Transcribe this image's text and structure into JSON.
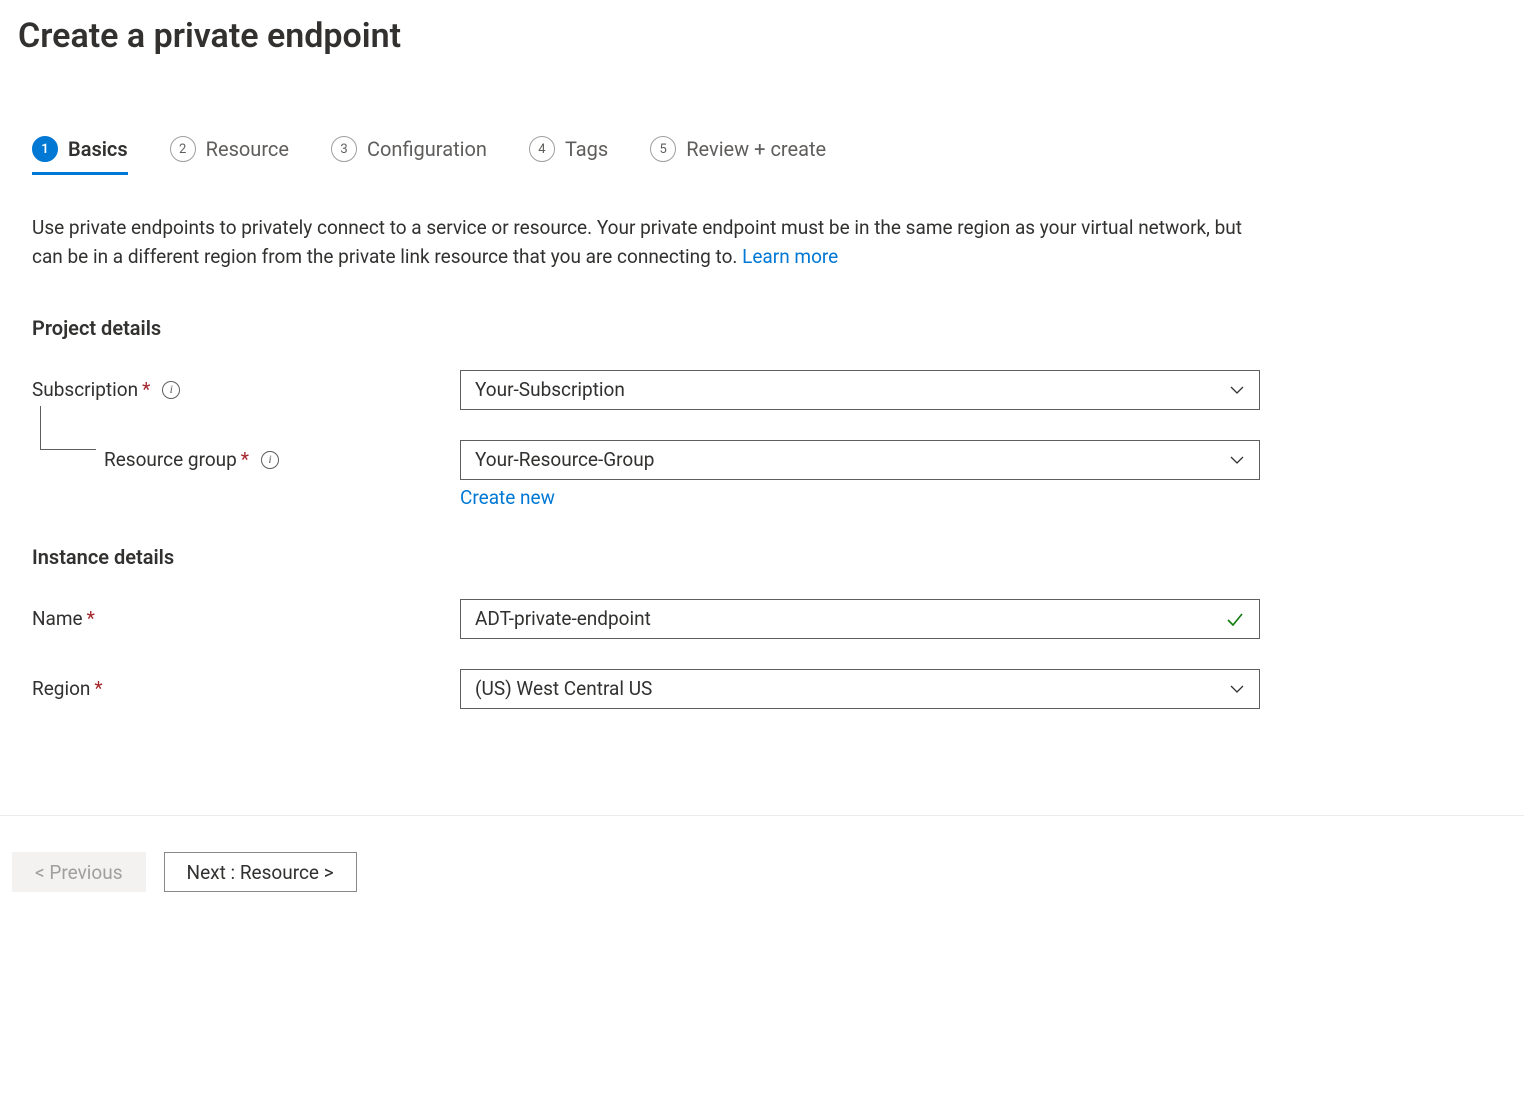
{
  "page_title": "Create a private endpoint",
  "tabs": [
    {
      "num": "1",
      "label": "Basics"
    },
    {
      "num": "2",
      "label": "Resource"
    },
    {
      "num": "3",
      "label": "Configuration"
    },
    {
      "num": "4",
      "label": "Tags"
    },
    {
      "num": "5",
      "label": "Review + create"
    }
  ],
  "description_text": "Use private endpoints to privately connect to a service or resource. Your private endpoint must be in the same region as your virtual network, but can be in a different region from the private link resource that you are connecting to.  ",
  "learn_more_label": "Learn more",
  "project_details": {
    "heading": "Project details",
    "subscription_label": "Subscription",
    "subscription_value": "Your-Subscription",
    "resource_group_label": "Resource group",
    "resource_group_value": "Your-Resource-Group",
    "create_new_label": "Create new"
  },
  "instance_details": {
    "heading": "Instance details",
    "name_label": "Name",
    "name_value": "ADT-private-endpoint",
    "region_label": "Region",
    "region_value": "(US) West Central US"
  },
  "footer": {
    "previous_label": "< Previous",
    "next_label": "Next : Resource >"
  }
}
